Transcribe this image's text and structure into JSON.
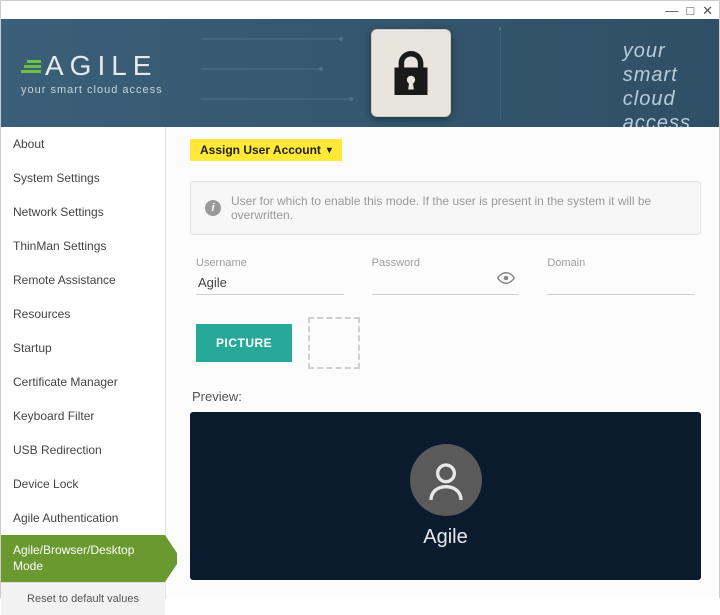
{
  "window": {
    "minimize": "—",
    "maximize": "□",
    "close": "✕"
  },
  "brand": {
    "name": "AGILE",
    "tagline": "your smart cloud access"
  },
  "header_tag": {
    "l1": "your",
    "l2": "smart",
    "l3": "cloud",
    "l4": "access"
  },
  "sidebar": {
    "items": [
      "About",
      "System Settings",
      "Network Settings",
      "ThinMan Settings",
      "Remote Assistance",
      "Resources",
      "Startup",
      "Certificate Manager",
      "Keyboard Filter",
      "USB Redirection",
      "Device Lock",
      "Agile Authentication",
      "Agile/Browser/Desktop Mode"
    ],
    "reset": "Reset to default values"
  },
  "main": {
    "assign_label": "Assign User Account",
    "info_text": "User for which to enable this mode. If the user is present in the system it will be overwritten.",
    "username_label": "Username",
    "username_value": "Agile",
    "password_label": "Password",
    "password_value": "",
    "domain_label": "Domain",
    "domain_value": "",
    "picture_btn": "PICTURE",
    "preview_label": "Preview:",
    "preview_name": "Agile"
  }
}
